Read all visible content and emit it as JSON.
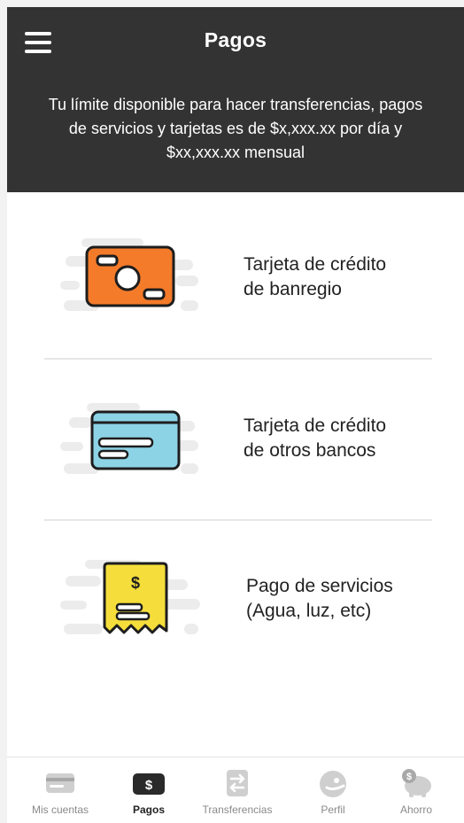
{
  "header": {
    "title": "Pagos",
    "notice": "Tu límite disponible para hacer transferencias, pagos de servicios y tarjetas es de $x,xxx.xx por día  y $xx,xxx.xx mensual"
  },
  "options": [
    {
      "line1": "Tarjeta de crédito",
      "line2": "de banregio",
      "icon": "credit-card-banregio-icon",
      "color": "#f47b2a"
    },
    {
      "line1": "Tarjeta de crédito",
      "line2": "de otros bancos",
      "icon": "credit-card-other-banks-icon",
      "color": "#8dd3e6"
    },
    {
      "line1": "Pago de servicios",
      "line2": "(Agua, luz, etc)",
      "icon": "receipt-icon",
      "color": "#f5de3b"
    }
  ],
  "tabbar": {
    "tabs": [
      {
        "label": "Mis cuentas",
        "icon": "card-icon"
      },
      {
        "label": "Pagos",
        "icon": "dollar-icon",
        "active": true
      },
      {
        "label": "Transferencias",
        "icon": "transfer-icon"
      },
      {
        "label": "Perfil",
        "icon": "profile-icon"
      },
      {
        "label": "Ahorro",
        "icon": "piggy-bank-icon"
      }
    ],
    "receipt_symbol": "$",
    "tab_symbol": "$"
  }
}
